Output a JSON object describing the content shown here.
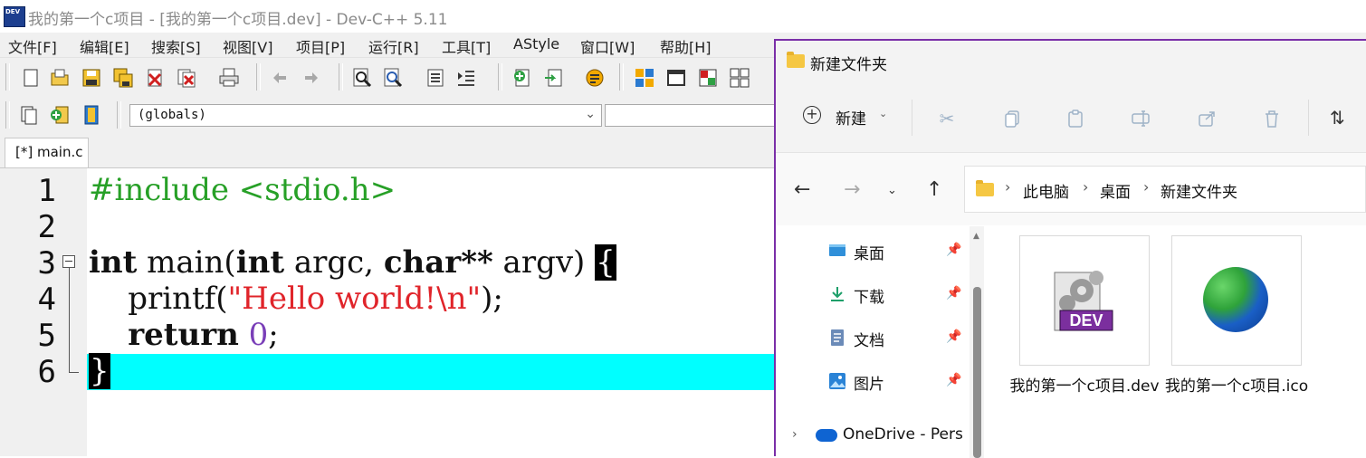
{
  "devcpp": {
    "title": "我的第一个c项目 - [我的第一个c项目.dev] - Dev-C++ 5.11",
    "menu": [
      "文件[F]",
      "编辑[E]",
      "搜索[S]",
      "视图[V]",
      "项目[P]",
      "运行[R]",
      "工具[T]",
      "AStyle",
      "窗口[W]",
      "帮助[H]"
    ],
    "scope_combo": "(globals)",
    "tab_label": "[*] main.c",
    "line_numbers": [
      "1",
      "2",
      "3",
      "4",
      "5",
      "6"
    ],
    "code": {
      "l1_include": "#include <stdio.h>",
      "l3_kw_int1": "int",
      "l3_main": " main(",
      "l3_kw_int2": "int",
      "l3_argc": " argc, ",
      "l3_kw_char": "char",
      "l3_stars": "**",
      "l3_argv": " argv) ",
      "l3_brace": "{",
      "l4_indent": "    ",
      "l4_printf": "printf(",
      "l4_string": "\"Hello world!\\n\"",
      "l4_end": ");",
      "l5_indent": "    ",
      "l5_return": "return",
      "l5_space": " ",
      "l5_zero": "0",
      "l5_end": ";",
      "l6_brace": "}"
    },
    "colors": {
      "preprocessor": "#27a027",
      "string": "#e0242a",
      "number": "#7a3fb8",
      "current_line": "#00ffff"
    }
  },
  "explorer": {
    "title": "新建文件夹",
    "new_button": "新建",
    "breadcrumb": [
      "此电脑",
      "桌面",
      "新建文件夹"
    ],
    "sidebar": [
      {
        "label": "桌面",
        "icon": "desktop-icon"
      },
      {
        "label": "下载",
        "icon": "download-icon"
      },
      {
        "label": "文档",
        "icon": "document-icon"
      },
      {
        "label": "图片",
        "icon": "pictures-icon"
      }
    ],
    "onedrive_label": "OneDrive - Pers",
    "files": [
      {
        "name": "我的第一个c项目.dev",
        "icon": "dev-project-icon"
      },
      {
        "name": "我的第一个c项目.ico",
        "icon": "globe-icon"
      }
    ],
    "accent": "#7a2fa8"
  }
}
